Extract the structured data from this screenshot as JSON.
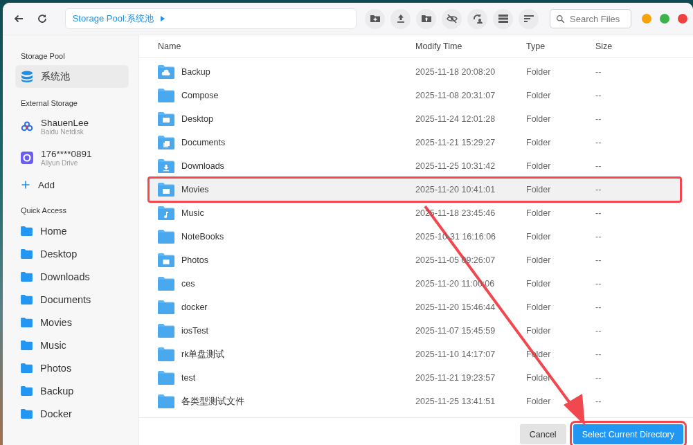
{
  "toolbar": {
    "path": "Storage Pool:系统池",
    "search": {
      "placeholder": "Search Files"
    }
  },
  "sidebar": {
    "sections": [
      {
        "title": "Storage Pool",
        "items": [
          {
            "kind": "pool",
            "label": "系统池",
            "selected": true
          }
        ]
      },
      {
        "title": "External Storage",
        "items": [
          {
            "kind": "baidu",
            "label": "ShauenLee",
            "sub": "Baidu Netdisk",
            "selected": false
          },
          {
            "kind": "aliyun",
            "label": "176****0891",
            "sub": "Aliyun Drive",
            "selected": false
          },
          {
            "kind": "add",
            "label": "Add",
            "selected": false
          }
        ]
      },
      {
        "title": "Quick Access",
        "items": [
          {
            "kind": "folder",
            "label": "Home",
            "selected": false
          },
          {
            "kind": "folder",
            "label": "Desktop",
            "selected": false
          },
          {
            "kind": "folder",
            "label": "Downloads",
            "selected": false
          },
          {
            "kind": "folder",
            "label": "Documents",
            "selected": false
          },
          {
            "kind": "folder",
            "label": "Movies",
            "selected": false
          },
          {
            "kind": "folder",
            "label": "Music",
            "selected": false
          },
          {
            "kind": "folder",
            "label": "Photos",
            "selected": false
          },
          {
            "kind": "folder",
            "label": "Backup",
            "selected": false
          },
          {
            "kind": "folder",
            "label": "Docker",
            "selected": false
          }
        ]
      }
    ]
  },
  "table": {
    "columns": [
      "Name",
      "Modify Time",
      "Type",
      "Size"
    ],
    "rows": [
      {
        "kind": "cloud",
        "name": "Backup",
        "time": "2025-11-18 20:08:20",
        "type": "Folder",
        "size": "--",
        "selected": false
      },
      {
        "kind": "plain",
        "name": "Compose",
        "time": "2025-11-08 20:31:07",
        "type": "Folder",
        "size": "--",
        "selected": false
      },
      {
        "kind": "monitor",
        "name": "Desktop",
        "time": "2025-11-24 12:01:28",
        "type": "Folder",
        "size": "--",
        "selected": false
      },
      {
        "kind": "documents",
        "name": "Documents",
        "time": "2025-11-21 15:29:27",
        "type": "Folder",
        "size": "--",
        "selected": false
      },
      {
        "kind": "download",
        "name": "Downloads",
        "time": "2025-11-25 10:31:42",
        "type": "Folder",
        "size": "--",
        "selected": false
      },
      {
        "kind": "movie",
        "name": "Movies",
        "time": "2025-11-20 10:41:01",
        "type": "Folder",
        "size": "--",
        "selected": true
      },
      {
        "kind": "music",
        "name": "Music",
        "time": "2025-11-18 23:45:46",
        "type": "Folder",
        "size": "--",
        "selected": false
      },
      {
        "kind": "plain",
        "name": "NoteBooks",
        "time": "2025-10-31 16:16:06",
        "type": "Folder",
        "size": "--",
        "selected": false
      },
      {
        "kind": "image",
        "name": "Photos",
        "time": "2025-11-05 09:26:07",
        "type": "Folder",
        "size": "--",
        "selected": false
      },
      {
        "kind": "plain",
        "name": "ces",
        "time": "2025-11-20 11:00:06",
        "type": "Folder",
        "size": "--",
        "selected": false
      },
      {
        "kind": "plain",
        "name": "docker",
        "time": "2025-11-20 15:46:44",
        "type": "Folder",
        "size": "--",
        "selected": false
      },
      {
        "kind": "plain",
        "name": "iosTest",
        "time": "2025-11-07 15:45:59",
        "type": "Folder",
        "size": "--",
        "selected": false
      },
      {
        "kind": "plain",
        "name": "rk单盘测试",
        "time": "2025-11-10 14:17:07",
        "type": "Folder",
        "size": "--",
        "selected": false
      },
      {
        "kind": "plain",
        "name": "test",
        "time": "2025-11-21 19:23:57",
        "type": "Folder",
        "size": "--",
        "selected": false
      },
      {
        "kind": "plain",
        "name": "各类型测试文件",
        "time": "2025-11-25 13:41:51",
        "type": "Folder",
        "size": "--",
        "selected": false
      }
    ]
  },
  "footer": {
    "buttons": [
      {
        "kind": "secondary",
        "label": "Cancel",
        "highlighted": false
      },
      {
        "kind": "primary",
        "label": "Select Current Directory",
        "highlighted": true
      }
    ]
  }
}
